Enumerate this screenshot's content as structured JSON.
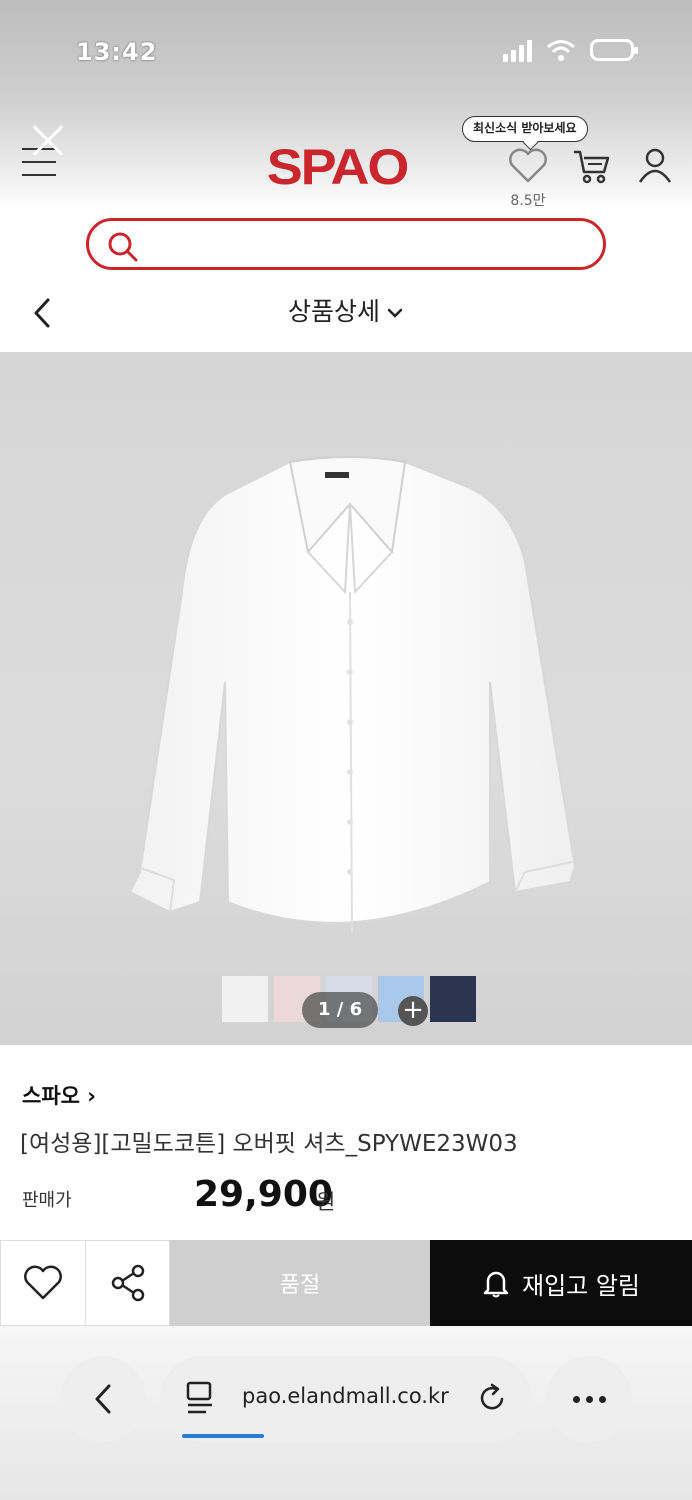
{
  "status": {
    "time": "13:42"
  },
  "header": {
    "logo": "SPAO",
    "tooltip": "최신소식 받아보세요",
    "wish_count": "8.5만"
  },
  "search": {
    "placeholder": ""
  },
  "title_bar": {
    "title": "상품상세"
  },
  "gallery": {
    "swatches": [
      "#f1f1f1",
      "#ecd8d6",
      "#d7dde6",
      "#a9c8ea",
      "#2c3550"
    ],
    "pager": "1 / 6",
    "plus": "+"
  },
  "product": {
    "brand": "스파오 ›",
    "name": "[여성용][고밀도코튼] 오버핏 셔츠_SPYWE23W03",
    "price_label": "판매가",
    "price": "29,900",
    "price_unit": "원"
  },
  "actions": {
    "soldout_label": "품절",
    "restock_label": "재입고 알림"
  },
  "browser": {
    "url": "pao.elandmall.co.kr"
  }
}
